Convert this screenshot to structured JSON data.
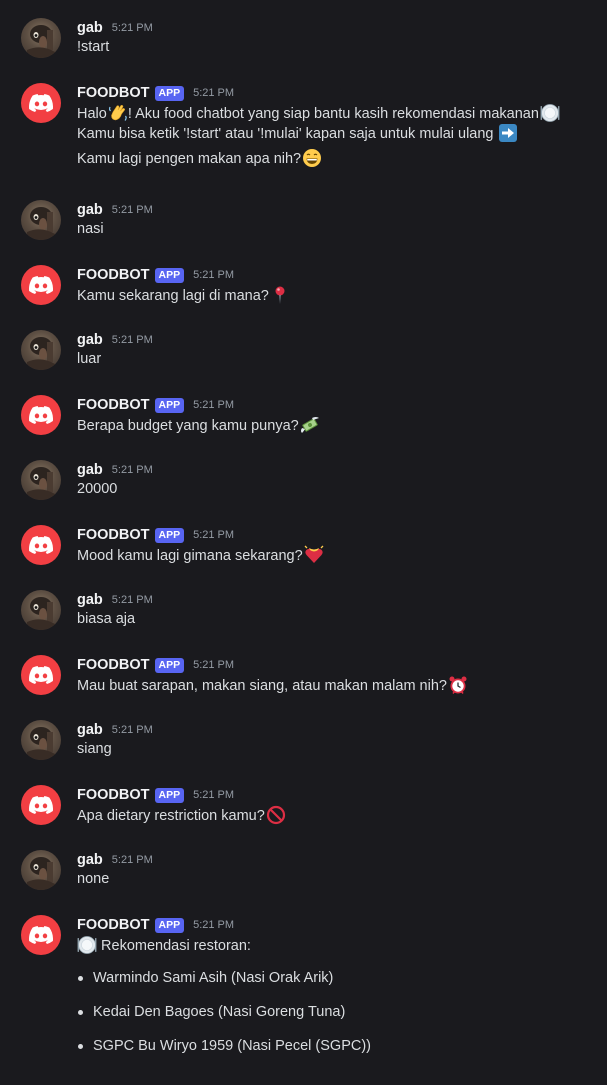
{
  "users": {
    "user": {
      "name": "gab"
    },
    "bot": {
      "name": "FOODBOT",
      "badge": "APP"
    }
  },
  "messages": [
    {
      "author": "gab",
      "time": "5:21 PM",
      "lines": [
        "!start"
      ]
    },
    {
      "author": "FOODBOT",
      "badge": "APP",
      "time": "5:21 PM",
      "lines": [
        "Halo",
        "! Aku food chatbot yang siap bantu kasih rekomendasi makanan",
        "Kamu bisa ketik '!start' atau '!mulai' kapan saja untuk mulai ulang",
        "Kamu lagi pengen makan apa nih?"
      ]
    },
    {
      "author": "gab",
      "time": "5:21 PM",
      "lines": [
        "nasi"
      ]
    },
    {
      "author": "FOODBOT",
      "badge": "APP",
      "time": "5:21 PM",
      "lines": [
        "Kamu sekarang lagi di mana?"
      ]
    },
    {
      "author": "gab",
      "time": "5:21 PM",
      "lines": [
        "luar"
      ]
    },
    {
      "author": "FOODBOT",
      "badge": "APP",
      "time": "5:21 PM",
      "lines": [
        "Berapa budget yang kamu punya?"
      ]
    },
    {
      "author": "gab",
      "time": "5:21 PM",
      "lines": [
        "20000"
      ]
    },
    {
      "author": "FOODBOT",
      "badge": "APP",
      "time": "5:21 PM",
      "lines": [
        "Mood kamu lagi gimana sekarang?"
      ]
    },
    {
      "author": "gab",
      "time": "5:21 PM",
      "lines": [
        "biasa aja"
      ]
    },
    {
      "author": "FOODBOT",
      "badge": "APP",
      "time": "5:21 PM",
      "lines": [
        "Mau buat sarapan, makan siang, atau makan malam nih?"
      ]
    },
    {
      "author": "gab",
      "time": "5:21 PM",
      "lines": [
        "siang"
      ]
    },
    {
      "author": "FOODBOT",
      "badge": "APP",
      "time": "5:21 PM",
      "lines": [
        "Apa dietary restriction kamu?"
      ]
    },
    {
      "author": "gab",
      "time": "5:21 PM",
      "lines": [
        "none"
      ]
    },
    {
      "author": "FOODBOT",
      "badge": "APP",
      "time": "5:21 PM",
      "lines": [
        " Rekomendasi restoran:"
      ],
      "recommendations": [
        "Warmindo Sami Asih (Nasi Orak Arik)",
        "Kedai Den Bagoes (Nasi Goreng Tuna)",
        "SGPC Bu Wiryo 1959 (Nasi Pecel (SGPC))"
      ]
    }
  ],
  "icons": {
    "bot_avatar": "discord-logo-icon",
    "user_avatar": "user-avatar-photo",
    "emojis": [
      "waving-hand-icon",
      "plate-icon",
      "right-arrow-icon",
      "grinning-face-icon",
      "round-pushpin-icon",
      "money-with-wings-icon",
      "heart-with-ribbon-icon",
      "alarm-clock-icon",
      "no-entry-sign-icon",
      "plate-icon"
    ]
  },
  "colors": {
    "background": "#1a1a1e",
    "username": "#f2f3f5",
    "text": "#dbdee1",
    "timestamp": "#949ba4",
    "app_badge": "#5865f2",
    "bot_avatar": "#f23f43"
  }
}
